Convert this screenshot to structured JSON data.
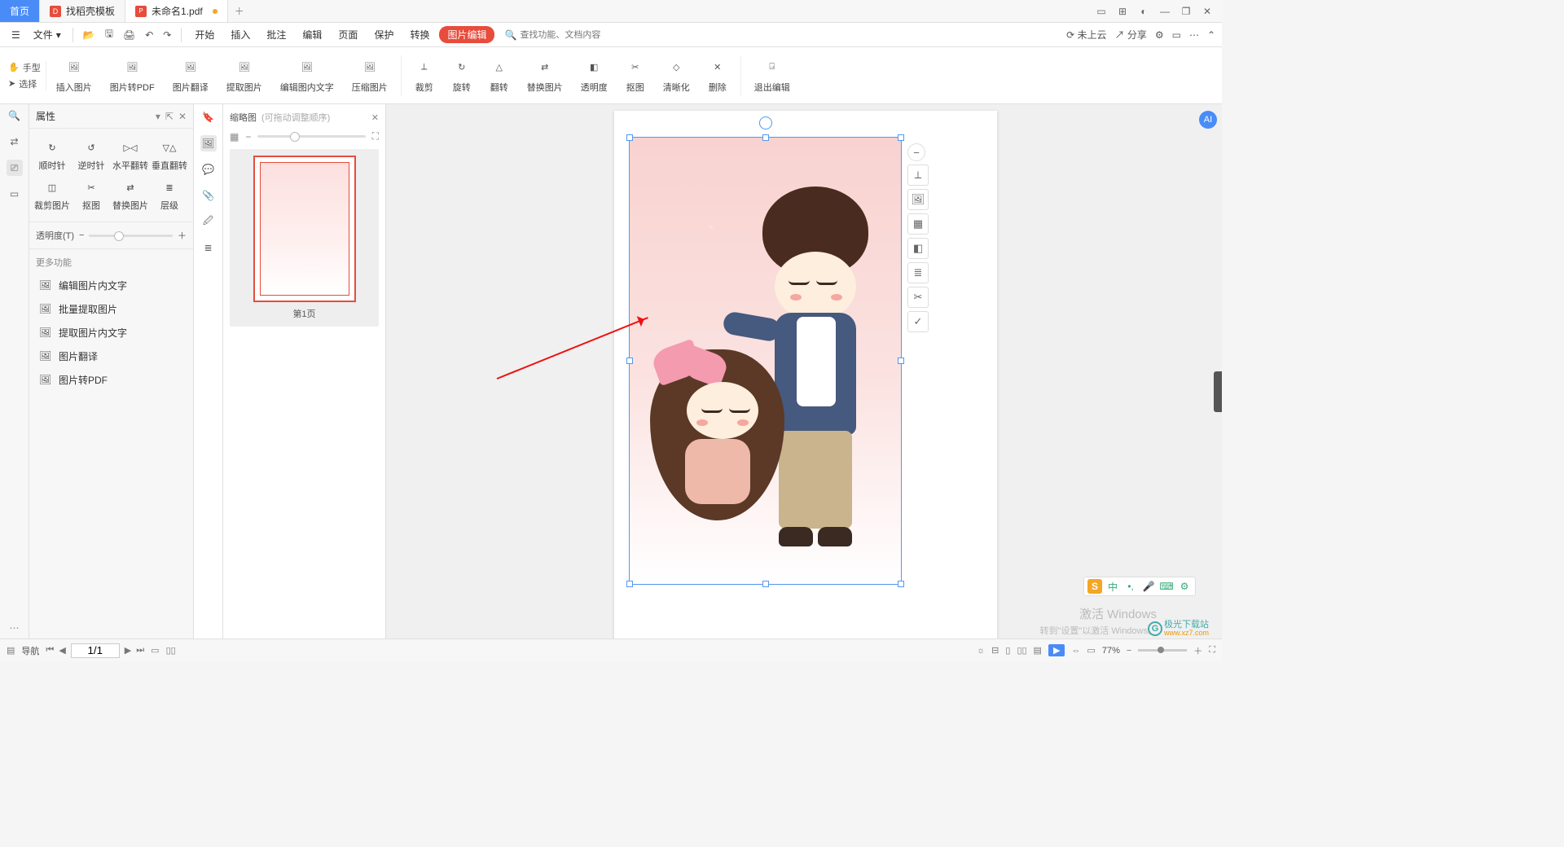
{
  "titlebar": {
    "tab_home": "首页",
    "tab_template": "找稻壳模板",
    "tab_doc": "未命名1.pdf"
  },
  "menubar": {
    "file": "文件",
    "items": [
      "开始",
      "插入",
      "批注",
      "编辑",
      "页面",
      "保护",
      "转换"
    ],
    "pill": "图片编辑",
    "search_placeholder": "查找功能、文档内容",
    "cloud": "未上云",
    "share": "分享"
  },
  "ribbon": {
    "hand": "手型",
    "select": "选择",
    "items": [
      "插入图片",
      "图片转PDF",
      "图片翻译",
      "提取图片",
      "编辑图内文字",
      "压缩图片",
      "裁剪",
      "旋转",
      "翻转",
      "替换图片",
      "透明度",
      "抠图",
      "清晰化",
      "删除",
      "退出编辑"
    ]
  },
  "props": {
    "title": "属性",
    "rotate": [
      "顺时针",
      "逆时针",
      "水平翻转",
      "垂直翻转"
    ],
    "row2": [
      "裁剪图片",
      "抠图",
      "替换图片",
      "层级"
    ],
    "opacity_label": "透明度(T)",
    "more_title": "更多功能",
    "more": [
      "编辑图片内文字",
      "批量提取图片",
      "提取图片内文字",
      "图片翻译",
      "图片转PDF"
    ]
  },
  "thumbs": {
    "title": "缩略图",
    "hint": "(可拖动调整顺序)",
    "page_label": "第1页"
  },
  "status": {
    "nav_label": "导航",
    "page": "1/1",
    "zoom": "77%"
  },
  "watermark": {
    "l1": "激活 Windows",
    "l2": "转到\"设置\"以激活 Windows。"
  },
  "ime": {
    "lang": "中"
  },
  "logo": {
    "text": "极光下载站",
    "url": "www.xz7.com"
  }
}
